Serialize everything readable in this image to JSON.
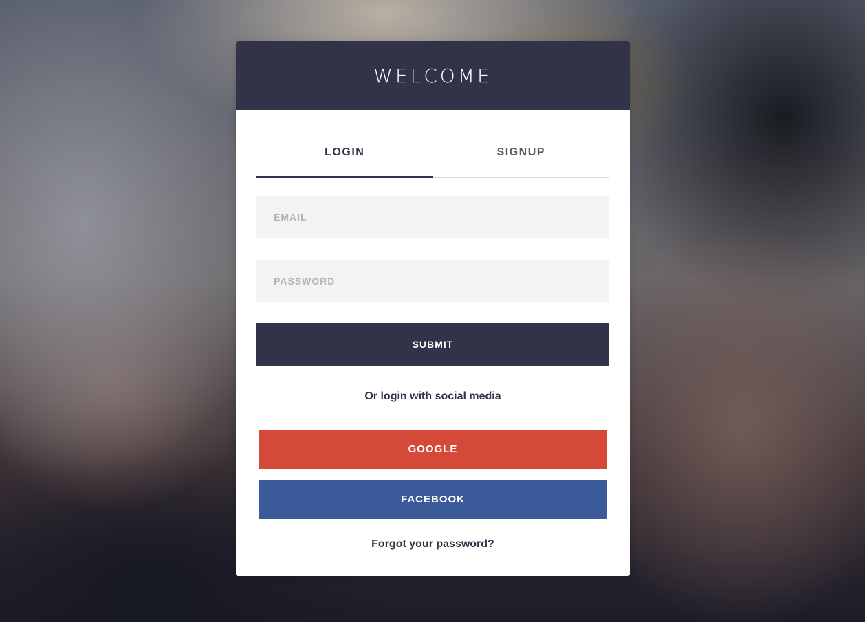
{
  "header": {
    "title": "WELCOME"
  },
  "tabs": [
    {
      "label": "LOGIN",
      "active": true
    },
    {
      "label": "SIGNUP",
      "active": false
    }
  ],
  "form": {
    "email": {
      "value": "",
      "placeholder": "EMAIL"
    },
    "password": {
      "value": "",
      "placeholder": "PASSWORD"
    },
    "submit_label": "SUBMIT"
  },
  "social": {
    "prompt": "Or login with social media",
    "google_label": "GOOGLE",
    "facebook_label": "FACEBOOK"
  },
  "forgot_label": "Forgot your password?",
  "colors": {
    "primary": "#323349",
    "google": "#d44937",
    "facebook": "#3a5a9a",
    "input_bg": "#f3f3f3"
  }
}
